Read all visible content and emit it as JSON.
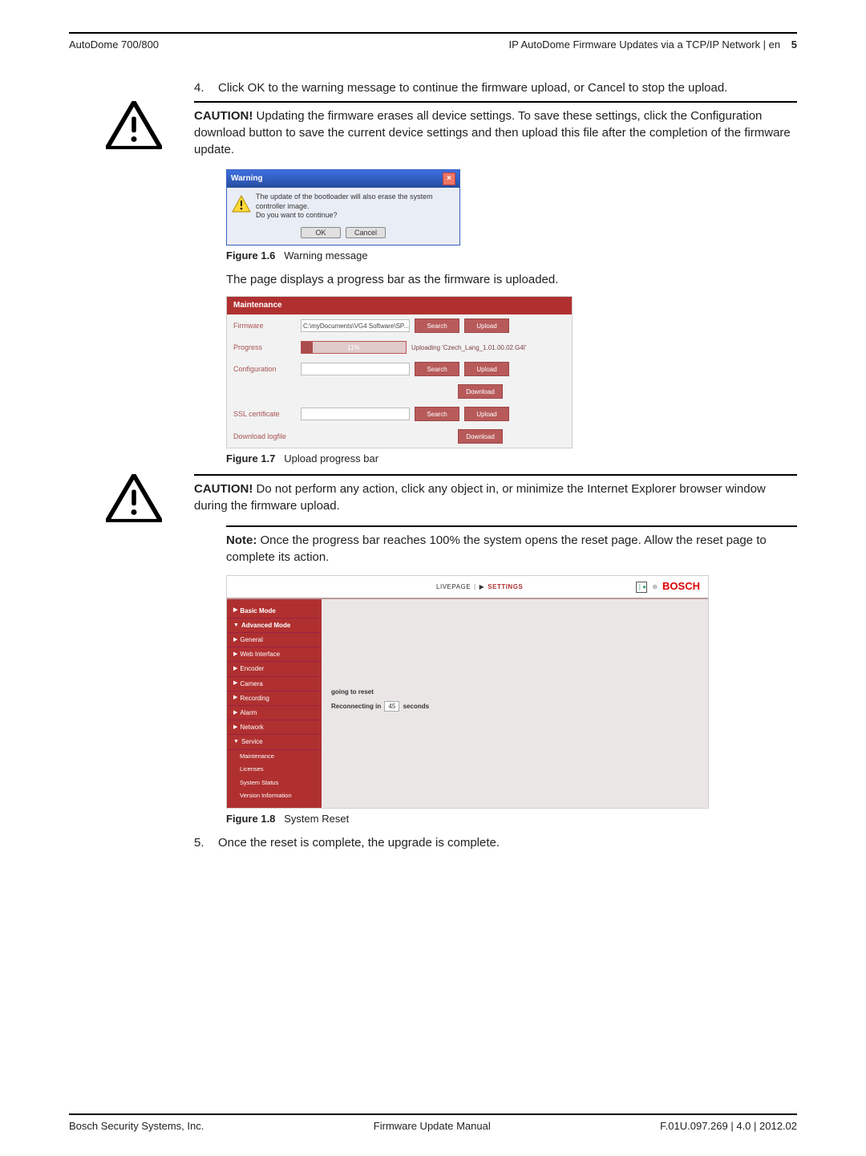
{
  "header": {
    "left": "AutoDome 700/800",
    "right_text": "IP AutoDome Firmware Updates via a TCP/IP Network | en",
    "page_number": "5"
  },
  "steps": {
    "s4_num": "4.",
    "s4_text": "Click OK to the warning message to continue the firmware upload, or Cancel to stop the upload.",
    "s5_num": "5.",
    "s5_text": "Once the reset is complete, the upgrade is complete."
  },
  "caution1": {
    "label": "CAUTION!",
    "text": " Updating the firmware erases all device settings. To save these settings, click the Configuration download button to save the current device settings and then upload this file after the completion of the firmware update."
  },
  "fig16": {
    "id": "Figure 1.6",
    "caption": "Warning message",
    "dialog": {
      "title": "Warning",
      "line1": "The update of the bootloader will also erase the system controller image.",
      "line2": "Do you want to continue?",
      "ok": "OK",
      "cancel": "Cancel"
    }
  },
  "after_fig16_text": "The page displays a progress bar as the firmware is uploaded.",
  "fig17": {
    "id": "Figure 1.7",
    "caption": "Upload progress bar",
    "panel": {
      "title": "Maintenance",
      "rows": {
        "firmware_label": "Firmware",
        "firmware_path": "C:\\myDocuments\\VG4 Software\\SP...",
        "progress_label": "Progress",
        "progress_pct": "11%",
        "progress_status": "Uploading 'Czech_Lang_1.01.00.02.G4l'",
        "config_label": "Configuration",
        "ssl_label": "SSL certificate",
        "logfile_label": "Download logfile"
      },
      "buttons": {
        "search": "Search",
        "upload": "Upload",
        "download": "Download"
      }
    }
  },
  "caution2": {
    "label": "CAUTION!",
    "text": " Do not perform any action, click any object in, or minimize the Internet Explorer browser window during the firmware upload."
  },
  "note": {
    "label": "Note:",
    "text": " Once the progress bar reaches 100% the system opens the reset page. Allow the reset page to complete its action."
  },
  "fig18": {
    "id": "Figure 1.8",
    "caption": "System Reset",
    "top": {
      "livepage": "LIVEPAGE",
      "settings": "SETTINGS",
      "brand": "BOSCH"
    },
    "sidebar": {
      "basic": "Basic Mode",
      "advanced": "Advanced Mode",
      "general": "General",
      "web": "Web Interface",
      "encoder": "Encoder",
      "camera": "Camera",
      "recording": "Recording",
      "alarm": "Alarm",
      "network": "Network",
      "service": "Service",
      "maintenance": "Maintenance",
      "licenses": "Licenses",
      "status": "System Status",
      "version": "Version Information"
    },
    "main": {
      "line1": "going to reset",
      "line2a": "Reconnecting in",
      "countdown": "45",
      "line2b": "seconds"
    }
  },
  "footer": {
    "left": "Bosch Security Systems, Inc.",
    "center": "Firmware Update Manual",
    "right": "F.01U.097.269 | 4.0 | 2012.02"
  },
  "chart_data": {
    "type": "table",
    "title": "Maintenance upload progress",
    "progress_percent": 11,
    "reset_countdown_seconds": 45
  }
}
